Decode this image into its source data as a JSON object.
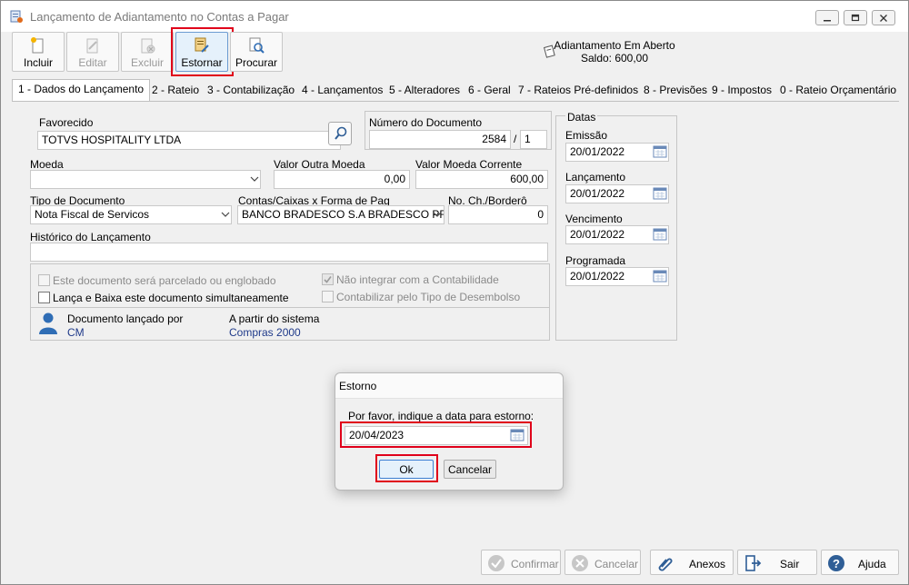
{
  "window": {
    "title": "Lançamento de Adiantamento no Contas a Pagar"
  },
  "toolbar": {
    "incluir": "Incluir",
    "editar": "Editar",
    "excluir": "Excluir",
    "estornar": "Estornar",
    "procurar": "Procurar"
  },
  "status": {
    "line1": "Adiantamento Em Aberto",
    "line2": "Saldo: 600,00"
  },
  "tabs": [
    "1 - Dados do Lançamento",
    "2 - Rateio",
    "3 - Contabilização",
    "4 - Lançamentos",
    "5 - Alteradores",
    "6 - Geral",
    "7 - Rateios Pré-definidos",
    "8 - Previsões",
    "9 - Impostos",
    "0 - Rateio Orçamentário"
  ],
  "form": {
    "favorecido_label": "Favorecido",
    "favorecido_value": "TOTVS HOSPITALITY LTDA",
    "numdoc_label": "Número do Documento",
    "numdoc_value": "2584",
    "numdoc_sep": "/",
    "numdoc_parcela": "1",
    "moeda_label": "Moeda",
    "moeda_value": "",
    "valor_outra_label": "Valor Outra Moeda",
    "valor_outra_value": "0,00",
    "valor_corrente_label": "Valor Moeda Corrente",
    "valor_corrente_value": "600,00",
    "tipodoc_label": "Tipo de Documento",
    "tipodoc_value": "Nota Fiscal de Servicos",
    "contas_label": "Contas/Caixas x Forma de Pag",
    "contas_value": "BANCO BRADESCO S.A BRADESCO PRIM",
    "noch_label": "No. Ch./Borderô",
    "noch_value": "0",
    "historico_label": "Histórico do Lançamento",
    "historico_value": "",
    "chk_parcelado": "Este documento será parcelado ou englobado",
    "chk_lanca_baixa": "Lança e Baixa este documento simultaneamente",
    "chk_nao_integrar": "Não integrar com a Contabilidade",
    "chk_contabilizar": "Contabilizar pelo Tipo de Desembolso",
    "lancado_por_label": "Documento lançado por",
    "lancado_por_value": "CM",
    "partir_label": "A partir do sistema",
    "partir_value": "Compras 2000"
  },
  "datas": {
    "title": "Datas",
    "emissao_label": "Emissão",
    "emissao_value": "20/01/2022",
    "lancamento_label": "Lançamento",
    "lancamento_value": "20/01/2022",
    "vencimento_label": "Vencimento",
    "vencimento_value": "20/01/2022",
    "programada_label": "Programada",
    "programada_value": "20/01/2022"
  },
  "dialog": {
    "title": "Estorno",
    "prompt": "Por favor, indique a data para estorno:",
    "date_value": "20/04/2023",
    "ok": "Ok",
    "cancel": "Cancelar"
  },
  "bottom": {
    "confirmar": "Confirmar",
    "cancelar": "Cancelar",
    "anexos": "Anexos",
    "sair": "Sair",
    "ajuda": "Ajuda"
  },
  "colors": {
    "highlight": "#e0001a",
    "link_blue": "#1f3a8a",
    "accent_blue": "#2f6db5"
  }
}
